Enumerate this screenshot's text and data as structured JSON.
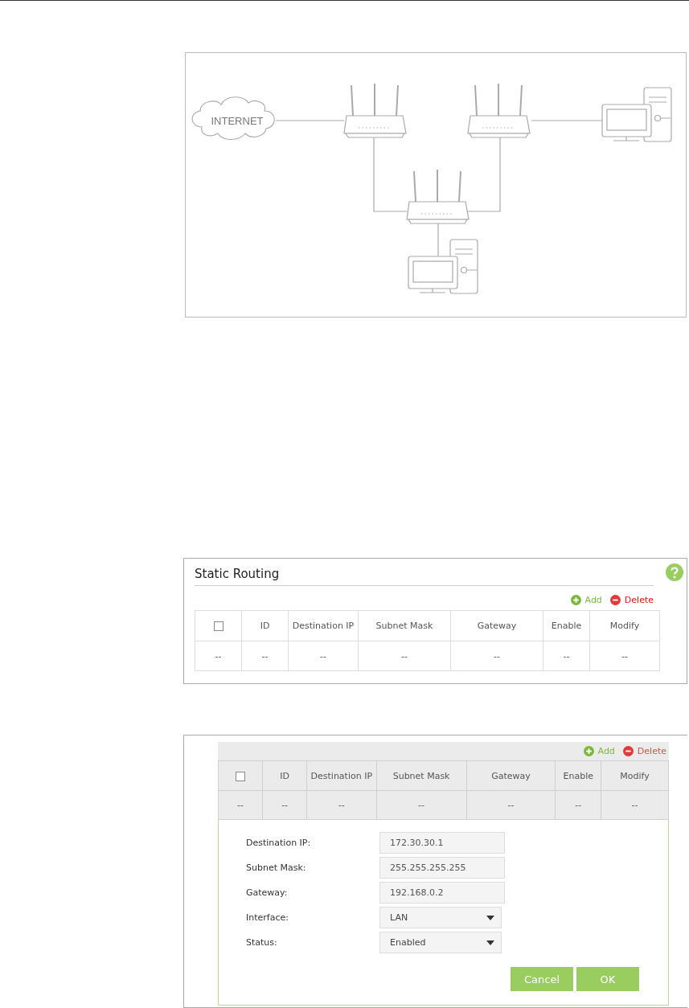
{
  "diagram": {
    "cloud_label": "INTERNET"
  },
  "static_routing": {
    "title": "Static Routing",
    "actions": [
      {
        "kind": "add",
        "label": "Add"
      },
      {
        "kind": "delete",
        "label": "Delete"
      }
    ],
    "columns": [
      {
        "kind": "checkbox",
        "checked": false
      },
      {
        "kind": "text",
        "label": "ID"
      },
      {
        "kind": "text",
        "label": "Destination IP"
      },
      {
        "kind": "text",
        "label": "Subnet Mask"
      },
      {
        "kind": "text",
        "label": "Gateway"
      },
      {
        "kind": "text",
        "label": "Enable"
      },
      {
        "kind": "text",
        "label": "Modify"
      }
    ],
    "rows": [
      [
        "--",
        "--",
        "--",
        "--",
        "--",
        "--",
        "--"
      ]
    ]
  },
  "edit_panel": {
    "actions": [
      {
        "kind": "add",
        "label": "Add"
      },
      {
        "kind": "delete",
        "label": "Delete"
      }
    ],
    "columns": [
      {
        "kind": "checkbox",
        "checked": false
      },
      {
        "kind": "text",
        "label": "ID"
      },
      {
        "kind": "text",
        "label": "Destination IP"
      },
      {
        "kind": "text",
        "label": "Subnet Mask"
      },
      {
        "kind": "text",
        "label": "Gateway"
      },
      {
        "kind": "text",
        "label": "Enable"
      },
      {
        "kind": "text",
        "label": "Modify"
      }
    ],
    "rows": [
      [
        "--",
        "--",
        "--",
        "--",
        "--",
        "--",
        "--"
      ]
    ],
    "fields": [
      {
        "kind": "text",
        "label": "Destination IP:",
        "value": "172.30.30.1"
      },
      {
        "kind": "text",
        "label": "Subnet Mask:",
        "value": "255.255.255.255"
      },
      {
        "kind": "text",
        "label": "Gateway:",
        "value": "192.168.0.2"
      },
      {
        "kind": "select",
        "label": "Interface:",
        "value": "LAN"
      },
      {
        "kind": "select",
        "label": "Status:",
        "value": "Enabled"
      }
    ],
    "buttons": [
      {
        "label": "Cancel"
      },
      {
        "label": "OK"
      }
    ]
  }
}
